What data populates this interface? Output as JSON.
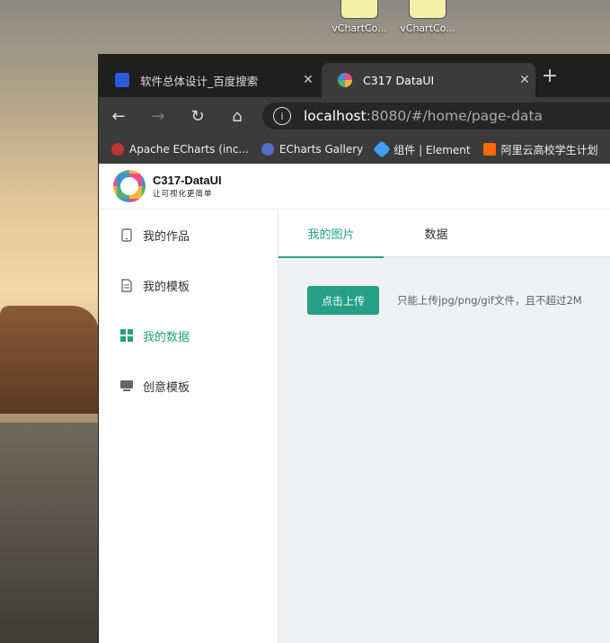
{
  "desktop": {
    "icons": [
      {
        "label": "vChartCo..."
      },
      {
        "label": "vChartCo..."
      }
    ]
  },
  "browser": {
    "tabs": [
      {
        "title": "软件总体设计_百度搜索",
        "icon": "baidu-paw-icon",
        "color": "#2d5bd8"
      },
      {
        "title": "C317 DataUI",
        "icon": "c317-logo-icon",
        "active": true
      }
    ],
    "new_tab": "+",
    "url": {
      "host": "localhost",
      "rest": ":8080/#/home/page-data"
    },
    "bookmarks": [
      {
        "label": "Apache ECharts (inc...",
        "icon": "echarts-icon",
        "color": "#c23531"
      },
      {
        "label": "ECharts Gallery",
        "icon": "gallery-icon",
        "color": "#5470c6"
      },
      {
        "label": "组件 | Element",
        "icon": "element-icon",
        "color": "#409eff"
      },
      {
        "label": "阿里云高校学生计划",
        "icon": "aliyun-icon",
        "color": "#ff6a00"
      }
    ]
  },
  "app": {
    "logo": {
      "name": "C317-DataUI",
      "slogan": "让可视化更简单"
    },
    "sidebar": {
      "items": [
        {
          "label": "我的作品",
          "icon": "phone-icon"
        },
        {
          "label": "我的模板",
          "icon": "document-icon"
        },
        {
          "label": "我的数据",
          "icon": "grid-icon",
          "active": true
        },
        {
          "label": "创意模板",
          "icon": "monitor-icon"
        }
      ]
    },
    "tabs": [
      {
        "label": "我的图片",
        "active": true
      },
      {
        "label": "数据"
      }
    ],
    "upload": {
      "button": "点击上传",
      "tip": "只能上传jpg/png/gif文件，且不超过2M"
    },
    "colors": {
      "accent": "#24a085"
    }
  }
}
